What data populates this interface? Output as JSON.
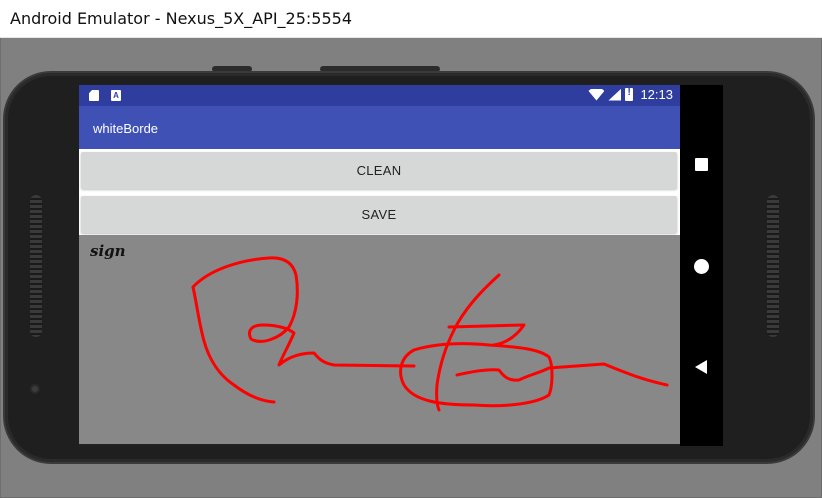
{
  "window": {
    "title": "Android Emulator - Nexus_5X_API_25:5554"
  },
  "status_bar": {
    "time": "12:13",
    "icons": [
      "sim-card-icon",
      "notification-a-icon",
      "wifi-icon",
      "signal-icon",
      "battery-icon"
    ],
    "a_glyph": "A"
  },
  "app_bar": {
    "title": "whiteBorde"
  },
  "buttons": {
    "clean_label": "CLEAN",
    "save_label": "SAVE"
  },
  "canvas": {
    "label": "sign",
    "stroke_color": "#ff0000",
    "background_color": "#888888"
  },
  "nav_bar": {
    "icons": [
      "recent-apps-icon",
      "home-icon",
      "back-icon"
    ]
  },
  "colors": {
    "status_bar": "#2f3e9e",
    "app_bar": "#3f51b5",
    "button": "#d6d7d7"
  }
}
